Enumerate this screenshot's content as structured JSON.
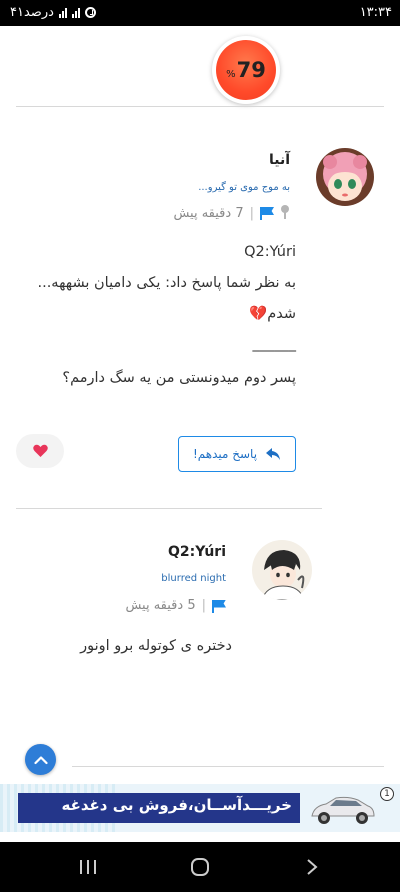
{
  "status_bar": {
    "time": "۱۳:۳۴",
    "battery_text": "۴۱درصد"
  },
  "score": {
    "value": "79",
    "unit": "%",
    "color": "#ff4a2a"
  },
  "comments": [
    {
      "author": "آنیا",
      "subtitle": "به موج موی تو گیرو...",
      "time": "7 دقیقه پیش",
      "body_lines": [
        "Q2:Yúri",
        "به نظر شما پاسخ داد: یکی دامیان بشههه...",
        "شدم💔",
        "______",
        "پسر دوم میدونستی من یه سگ دارمم؟"
      ]
    },
    {
      "author": "Q2:Yúri",
      "subtitle": "blurred night",
      "time": "5 دقیقه پیش",
      "body_lines": [
        "دختره ی کوتوله برو اونور"
      ]
    }
  ],
  "actions": {
    "reply_label": "پاسخ میدهم!",
    "heart_icon": "heart-icon"
  },
  "ad": {
    "text": "خریـــدآســان،فروش بی دغدغه",
    "badge": "1"
  },
  "colors": {
    "accent": "#1e8ae6",
    "ad_band": "#24368a"
  }
}
